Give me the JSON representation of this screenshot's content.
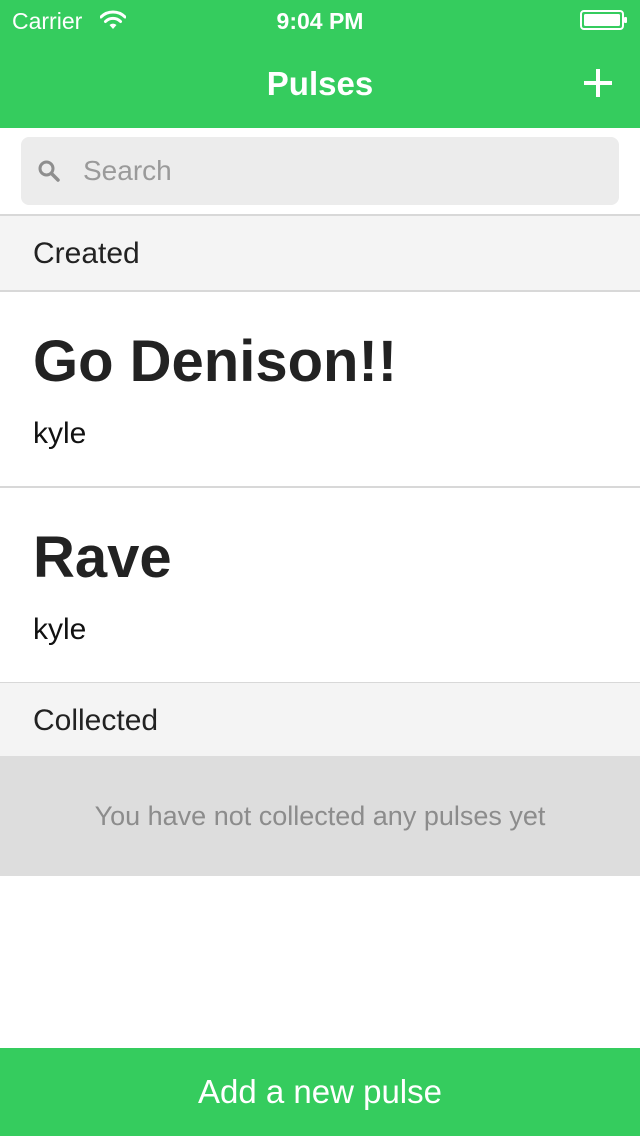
{
  "status_bar": {
    "carrier": "Carrier",
    "time": "9:04 PM",
    "wifi_icon": "wifi-icon",
    "battery_icon": "battery-icon"
  },
  "nav_bar": {
    "title": "Pulses",
    "add_icon": "plus-icon"
  },
  "search": {
    "placeholder": "Search",
    "value": "",
    "icon": "search-icon"
  },
  "sections": {
    "created": {
      "label": "Created",
      "items": [
        {
          "title": "Go Denison!!",
          "author": "kyle"
        },
        {
          "title": "Rave",
          "author": "kyle"
        }
      ]
    },
    "collected": {
      "label": "Collected",
      "empty_message": "You have not collected any pulses yet"
    }
  },
  "bottom_action": {
    "label": "Add a new pulse"
  },
  "colors": {
    "brand_green": "#35cc5e",
    "section_header_bg": "#f4f4f4",
    "empty_state_bg": "#dddddd",
    "separator": "#d8d8d8"
  }
}
